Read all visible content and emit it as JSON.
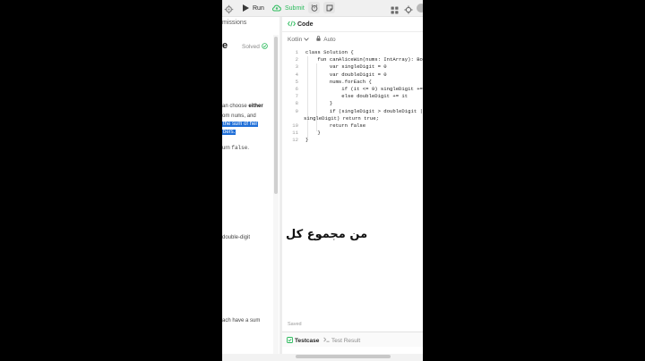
{
  "toolbar": {
    "run_label": "Run",
    "submit_label": "Submit",
    "icons": [
      "gear-icon",
      "play-icon",
      "cloud-upload-icon",
      "timer-icon",
      "note-icon",
      "layout-icon",
      "settings-icon",
      "avatar-icon"
    ]
  },
  "left_panel": {
    "tab_fragment": "missions",
    "title_fragment": "e",
    "solved_label": "Solved",
    "desc_lines": [
      {
        "pre": "an choose ",
        "bold": "either"
      },
      {
        "pre": "om ",
        "mono": "nums",
        "post": ", and"
      },
      {
        "selected": "the sum of her"
      },
      {
        "selected": "bers."
      }
    ],
    "return_fragment": {
      "pre": "urn ",
      "mono": "false",
      "post": "."
    },
    "double_digit_fragment": "double-digit",
    "sum_fragment": "ach have a sum"
  },
  "code_panel": {
    "title": "Code",
    "language": "Kotlin",
    "mode": "Auto",
    "lines": [
      {
        "n": "1",
        "t": "class Solution {"
      },
      {
        "n": "2",
        "t": "    fun canAliceWin(nums: IntArray): Bool"
      },
      {
        "n": "3",
        "t": "        var singleDigit = 0"
      },
      {
        "n": "4",
        "t": "        var doubleDigit = 0"
      },
      {
        "n": "5",
        "t": "        nums.forEach {"
      },
      {
        "n": "6",
        "t": "            if (it <= 9) singleDigit += i"
      },
      {
        "n": "7",
        "t": "            else doubleDigit += it"
      },
      {
        "n": "8",
        "t": "        }"
      },
      {
        "n": "9",
        "t": "        if (singleDigit > doubleDigit ||"
      },
      {
        "n": "",
        "t": "singleDigit) return true;"
      },
      {
        "n": "10",
        "t": "        return false"
      },
      {
        "n": "11",
        "t": "    }"
      },
      {
        "n": "12",
        "t": "}"
      }
    ],
    "overlay_text": "من مجموع كل",
    "saved_label": "Saved",
    "bottom_tabs": {
      "testcase": "Testcase",
      "test_result": "Test Result"
    }
  },
  "colors": {
    "accent_green": "#2cbb5d",
    "selection_blue": "#1f6fd8",
    "keyword_blue": "#0b3fa3"
  }
}
